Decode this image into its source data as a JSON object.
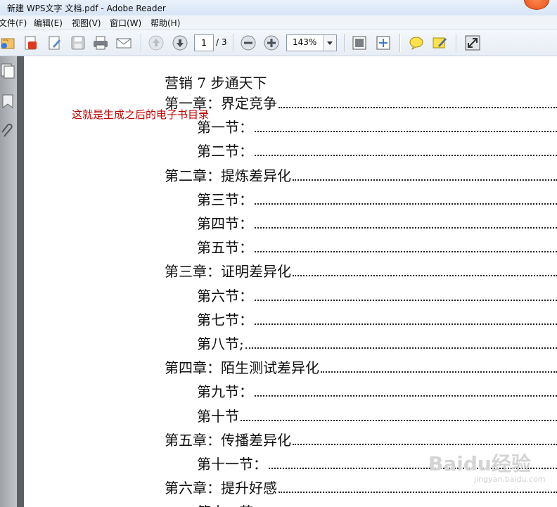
{
  "window": {
    "title": "新建 WPS文字 文档.pdf - Adobe Reader"
  },
  "menu": {
    "items": [
      "文件(F)",
      "编辑(E)",
      "视图(V)",
      "窗口(W)",
      "帮助(H)"
    ]
  },
  "toolbar": {
    "page_current": "1",
    "page_total": "/ 3",
    "zoom": "143%"
  },
  "document": {
    "title": "营销 7 步通天下",
    "annotation": "这就是生成之后的电子书目录",
    "watermark": "Baidu经验",
    "watermark_sub": "jingyan.baidu.com",
    "toc": [
      {
        "label": "第一章：界定竞争",
        "level": 1
      },
      {
        "label": "第一节：",
        "level": 2
      },
      {
        "label": "第二节：",
        "level": 2
      },
      {
        "label": "第二章：提炼差异化",
        "level": 1
      },
      {
        "label": "第三节：",
        "level": 2
      },
      {
        "label": "第四节：",
        "level": 2
      },
      {
        "label": "第五节：",
        "level": 2
      },
      {
        "label": "第三章：证明差异化",
        "level": 1
      },
      {
        "label": "第六节：",
        "level": 2
      },
      {
        "label": "第七节：",
        "level": 2
      },
      {
        "label": "第八节;",
        "level": 2
      },
      {
        "label": "第四章：陌生测试差异化",
        "level": 1
      },
      {
        "label": "第九节：",
        "level": 2
      },
      {
        "label": "第十节",
        "level": 2
      },
      {
        "label": "第五章：传播差异化",
        "level": 1
      },
      {
        "label": "第十一节：",
        "level": 2
      },
      {
        "label": "第六章：提升好感",
        "level": 1
      },
      {
        "label": "第十二节",
        "level": 2
      }
    ]
  }
}
